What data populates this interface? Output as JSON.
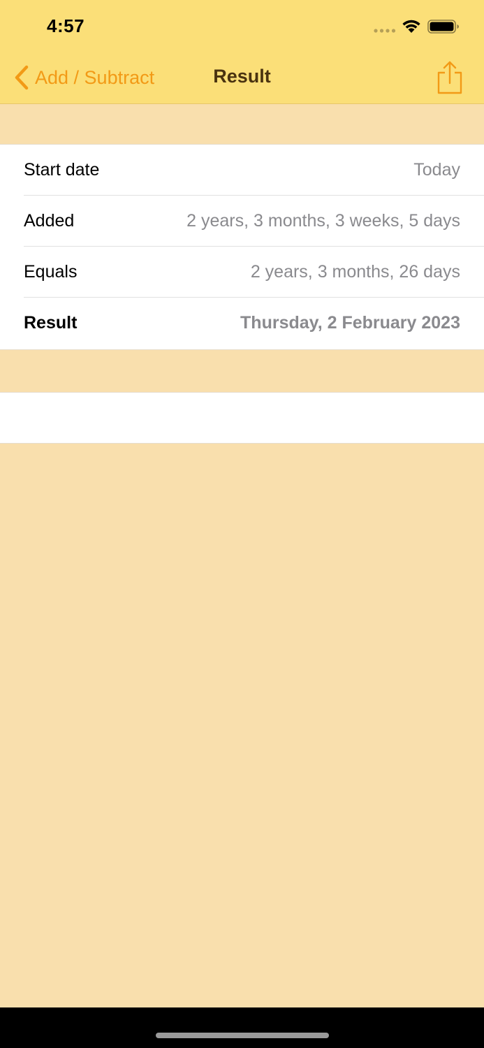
{
  "status_bar": {
    "time": "4:57",
    "signal_icon": "signal-dots-icon",
    "wifi_icon": "wifi-icon",
    "battery_icon": "battery-icon"
  },
  "nav": {
    "back_label": "Add / Subtract",
    "back_icon": "chevron-left-icon",
    "title": "Result",
    "share_icon": "share-icon"
  },
  "rows": [
    {
      "label": "Start date",
      "value": "Today"
    },
    {
      "label": "Added",
      "value": "2 years, 3 months, 3 weeks, 5 days"
    },
    {
      "label": "Equals",
      "value": "2 years, 3 months, 26 days"
    },
    {
      "label": "Result",
      "value": "Thursday, 2 February 2023"
    }
  ],
  "colors": {
    "header_bg": "#fbdf78",
    "page_bg": "#f9dfad",
    "accent": "#f29a16",
    "title": "#4a3310",
    "value_text": "#8a8a8e"
  }
}
